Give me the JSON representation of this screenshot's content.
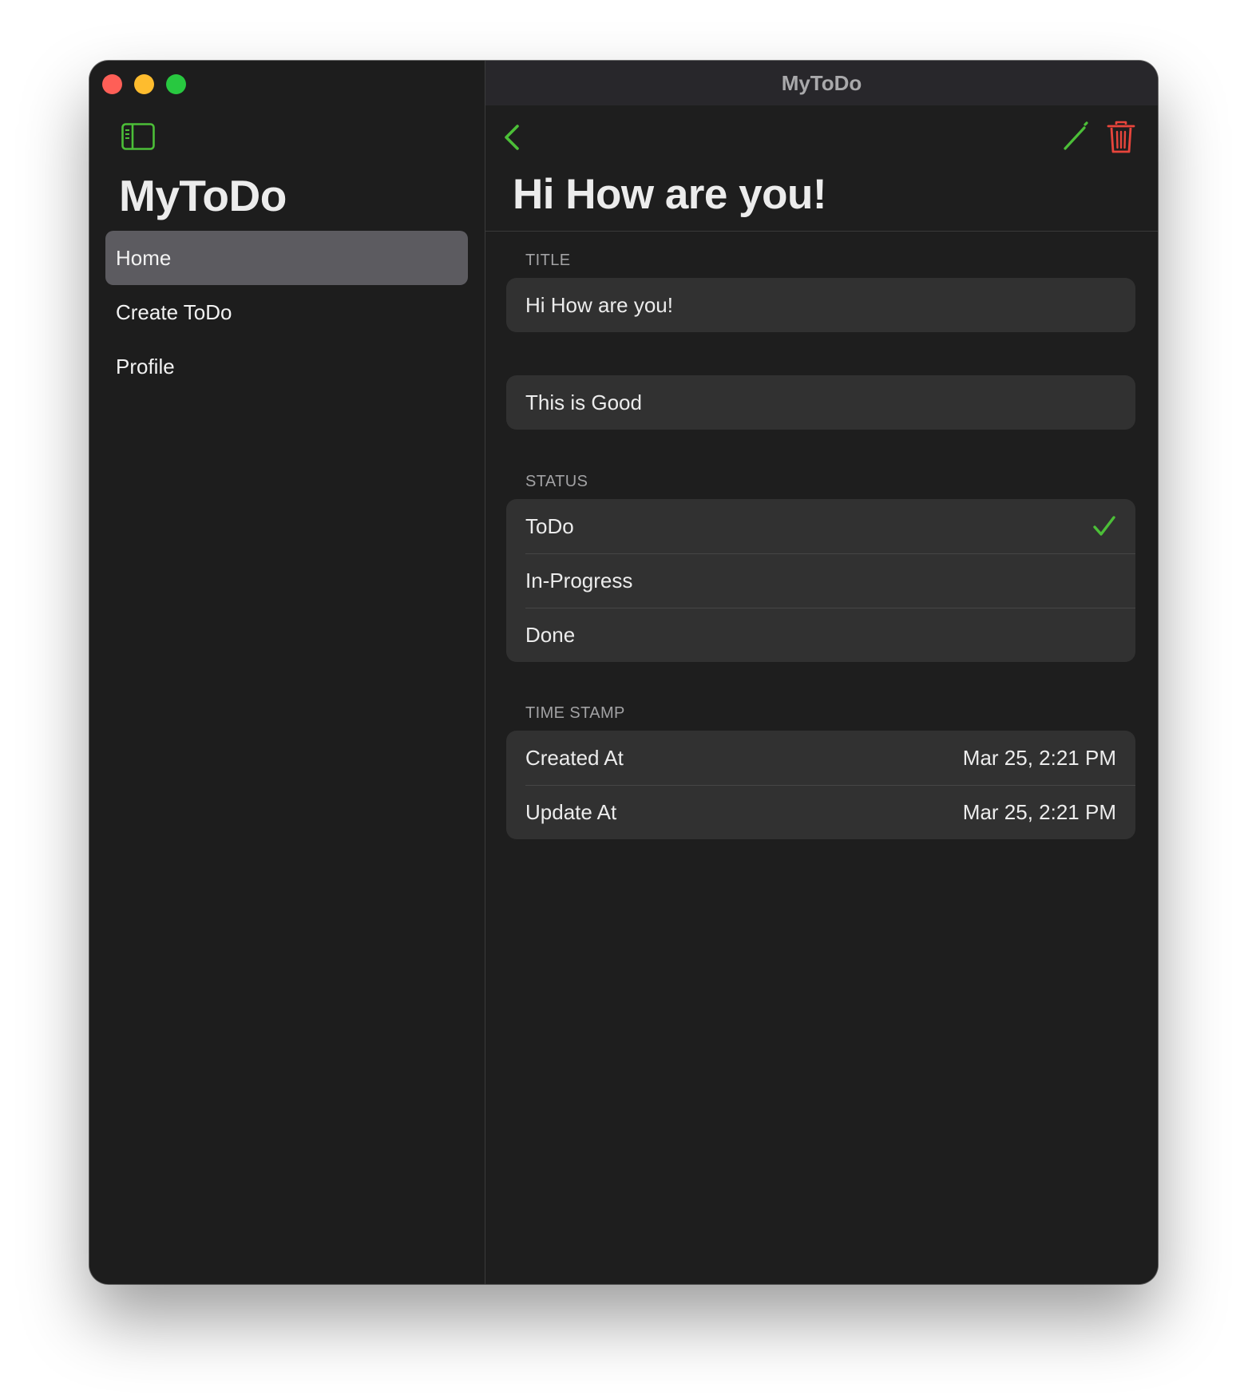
{
  "window": {
    "title": "MyToDo"
  },
  "sidebar": {
    "title": "MyToDo",
    "items": [
      {
        "label": "Home",
        "active": true
      },
      {
        "label": "Create ToDo",
        "active": false
      },
      {
        "label": "Profile",
        "active": false
      }
    ]
  },
  "toolbar": {
    "back_icon": "chevron-left-icon",
    "edit_icon": "pencil-icon",
    "delete_icon": "trash-icon"
  },
  "detail": {
    "heading": "Hi How are you!",
    "title_section": {
      "label": "TITLE",
      "value": "Hi How are you!"
    },
    "description": {
      "value": "This is Good"
    },
    "status_section": {
      "label": "STATUS",
      "options": [
        "ToDo",
        "In-Progress",
        "Done"
      ],
      "selected": "ToDo"
    },
    "timestamp_section": {
      "label": "TIME STAMP",
      "created_label": "Created At",
      "created_value": "Mar 25, 2:21 PM",
      "updated_label": "Update At",
      "updated_value": "Mar 25, 2:21 PM"
    }
  },
  "colors": {
    "accent_green": "#4cbf38",
    "destructive_red": "#e8453c",
    "selected_row": "#5c5b60"
  }
}
